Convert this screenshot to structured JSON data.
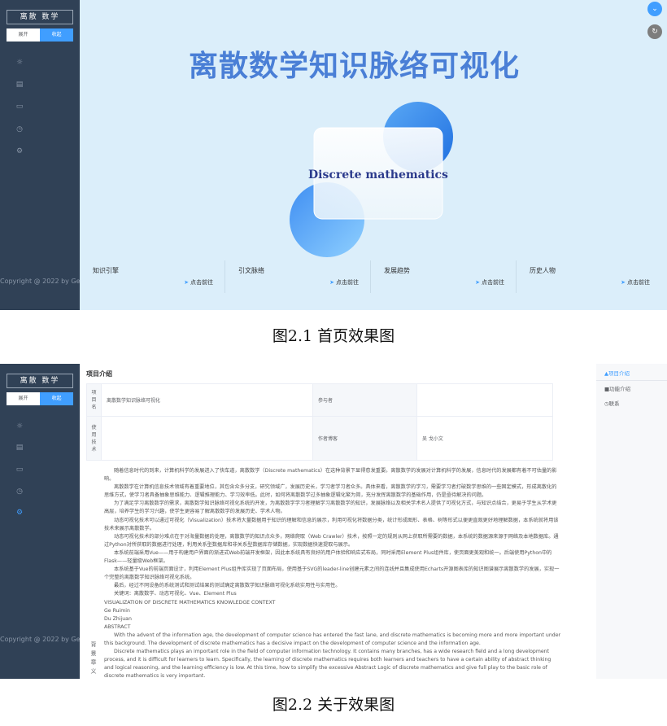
{
  "shot1": {
    "brand": "离散 数学",
    "toggle": {
      "open": "展开",
      "close": "收起"
    },
    "sidebar_icons": [
      "sun-icon",
      "document-icon",
      "monitor-icon",
      "clock-icon",
      "gear-icon"
    ],
    "copyright": "Copyright @ 2022 by Ge",
    "hero_title": "离散数学知识脉络可视化",
    "hero_card_text": "Discrete mathematics",
    "cards": [
      {
        "title": "知识引擎",
        "link": "点击前往"
      },
      {
        "title": "引文脉络",
        "link": "点击前往"
      },
      {
        "title": "发展趋势",
        "link": "点击前往"
      },
      {
        "title": "历史人物",
        "link": "点击前往"
      }
    ],
    "colors": {
      "sidebar": "#304156",
      "main_bg": "#dbeefa",
      "accent": "#409eff",
      "title": "#4a7fd6"
    }
  },
  "caption1": "图2.1 首页效果图",
  "shot2": {
    "brand": "离散 数学",
    "toggle": {
      "open": "展开",
      "close": "收起"
    },
    "copyright": "Copyright @ 2022 by Ge",
    "section_title": "项目介绍",
    "table": {
      "row1": {
        "label": "项目名",
        "value": "离散数学知识脉络可视化",
        "label2": "参与者",
        "value2": ""
      },
      "row2": {
        "label": "使用技术",
        "value": "",
        "label2": "作者博客",
        "value2": "吴 戈小文"
      }
    },
    "paragraphs": [
      "随着信息时代的到来，计算机科学的发展进入了快车道，离散数学（Discrete mathematics）在这种背景下显得愈发重要。离散数学的发展对计算机科学的发展，信息时代的发展都有着不可估量的影响。",
      "离散数学在计算机信息技术领域有着重要地位，其包含众多分支，研究领域广，发展历史长，学习者学习者众多。具体来看，离散数学的学习，需要学习者打破数学思维的一些固定模式，形成离散化的思维方式，使学习者具备抽象思维能力、逻辑推理能力、学习效率低。此时，如何将离散数学过多抽象逻辑化繁为简，充分发挥离散数学的基础作用，仍是亟待解决的问题。",
      "为了满足学习离散数学的需求，离散数学知识脉络可视化系统的开发，为离散数学学习者理解学习离散数学的知识，发展脉络以及相关学术名人提供了可视化方式，与知识点结合，更易于学生从学术更高层，培养学生的学习兴趣，使学生更容易了解离散数学的发展历史、学术人物。",
      "动态可视化技术可以通过可视化（Visualization）技术将大量数据用于知识的理解和信息的展示，利用可视化将数据分类，统计形成图形、表格、树等形式以便更直观更好地理解数据，本系统就将用该技术来展示离散数学。",
      "动态可视化技术的部分难点在于对海量数据的处理，离散数学的知识点众多，网络爬取（Web Crawler）技术，按照一定的规则从网上获取所需要的数据，本系统的数据源来源于网络及本地数据库。通过Python对所获取的数据进行处理，利用关系型数据库和非关系型数据库存储数据，实现数据快速提取与展示。",
      "本系统前端采用Vue——用于构建用户界面的渐进式Web前端开发框架，因此本系统具有良好的用户体验和响应式布局，同时采用Element Plus组件库，使页面更美观和统一。后端使用Python中的Flask——轻量级Web框架。",
      "本系统基于Vue的前端页面设计，利用Element Plus组件库实现了页面布局，使用基于SVG的leader-line创建元素之间的连线并且集成使用Echarts开源图表库的知识图谱展示离散数学的发展，实现一个完整的离散数学知识脉络可视化系统。",
      "最后，经过不同设备的系统测试和测试结果的测试确定离散数学知识脉络可视化系统实用性与实用性。",
      "关键词：离散数学、动态可视化、Vue、Element Plus"
    ],
    "english_header": [
      "VISUALIZATION OF DISCRETE MATHEMATICS KNOWLEDGE CONTEXT",
      "Ge Ruimin",
      "Du Zhijuan",
      "ABSTRACT"
    ],
    "english_paragraphs": [
      "With the advent of the information age, the development of computer science has entered the fast lane, and discrete mathematics is becoming more and more important under this background. The development of discrete mathematics has a decisive impact on the development of computer science and the information age.",
      "Discrete mathematics plays an important role in the field of computer information technology. It contains many branches, has a wide research field and a long development process, and it is difficult for learners to learn. Specifically, the learning of discrete mathematics requires both learners and teachers to have a certain ability of abstract thinking and logical reasoning, and the learning efficiency is low. At this time, how to simplify the excessive Abstract Logic of discrete mathematics and give full play to the basic role of discrete mathematics is very important."
    ],
    "background_label": "背景章义",
    "right_nav": [
      "项目介绍",
      "功能介绍",
      "联系"
    ]
  },
  "caption2": "图2.2 关于效果图"
}
